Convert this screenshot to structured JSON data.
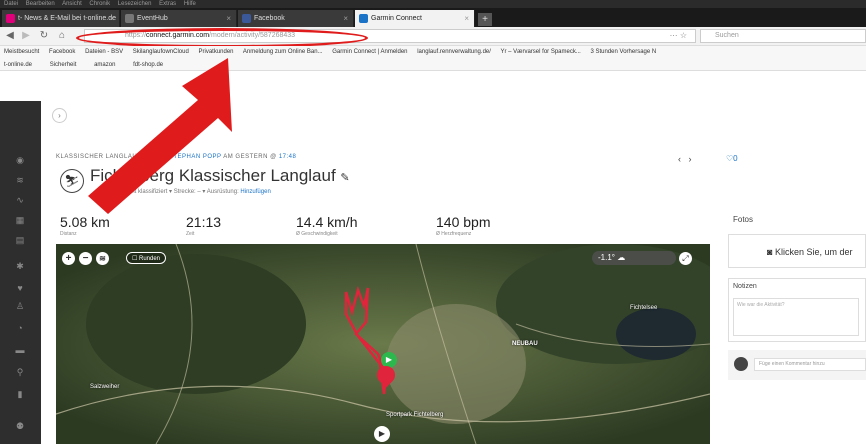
{
  "browser": {
    "menu": [
      "Datei",
      "Bearbeiten",
      "Ansicht",
      "Chronik",
      "Lesezeichen",
      "Extras",
      "Hilfe"
    ],
    "tabs": [
      {
        "label": "t- News & E-Mail bei t-online.de",
        "color": "#e2007a"
      },
      {
        "label": "EventHub",
        "color": "#555"
      },
      {
        "label": "Facebook",
        "color": "#3b5998"
      },
      {
        "label": "Garmin Connect",
        "color": "#1a73c7"
      }
    ],
    "new_tab": "+",
    "url_prefix": "https://",
    "url_domain": "connect.garmin.com",
    "url_path": "/modern/activity/587268433",
    "url_menu": "···",
    "url_star": "☆",
    "search_placeholder": "Suchen",
    "bookmarks": [
      "Meistbesucht",
      "Facebook",
      "Dateien - BSV",
      "SkilanglaufownCloud",
      "Privatkunden",
      "Anmeldung zum Online Ban...",
      "Garmin Connect | Anmelden",
      "langlauf.rennverwaltung.de/",
      "Yr – Værvarsel for Spameck...",
      "3 Stunden Vorhersage N"
    ],
    "bookmarks2": [
      "t-online.de",
      "Sicherheit",
      "amazon",
      "fdt-shop.de"
    ]
  },
  "activity": {
    "breadcrumb_type": "KLASSISCHER LANGLAUF",
    "breadcrumb_by": "▼ VON",
    "breadcrumb_author": "STEPHAN POPP",
    "breadcrumb_when": "AM GESTERN @",
    "breadcrumb_time": "17:48",
    "title": "Fichtelberg Klassischer Langlauf",
    "edit_icon": "✎",
    "subline_prefix": "Eventtyp: Nicht klassifiziert ▾  Strecke: – ▾  Ausrüstung:",
    "subline_link": "Hinzufügen",
    "likes": "♡0",
    "stats": [
      {
        "value": "5.08 km",
        "label": "Distanz"
      },
      {
        "value": "21:13",
        "label": "Zeit"
      },
      {
        "value": "14.4 km/h",
        "label": "Ø Geschwindigkeit"
      },
      {
        "value": "140 bpm",
        "label": "Ø Herzfrequenz"
      }
    ]
  },
  "map": {
    "runden_label": "Runden",
    "weather": "-1.1°",
    "labels": [
      "NEUBAU",
      "Salzweiher",
      "Fichtelsee",
      "Sportpark Fichtelberg"
    ]
  },
  "sidebar": {
    "logo": "C"
  },
  "right": {
    "fotos_title": "Fotos",
    "photo_button": "Klicken Sie, um der",
    "notes_title": "Notizen",
    "notes_placeholder": "Wie war die Aktivität?",
    "comment_placeholder": "Füge einen Kommentar hinzu"
  },
  "colors": {
    "annotation": "#e01b1b",
    "link": "#1a73c7",
    "route": "#e0243c"
  }
}
